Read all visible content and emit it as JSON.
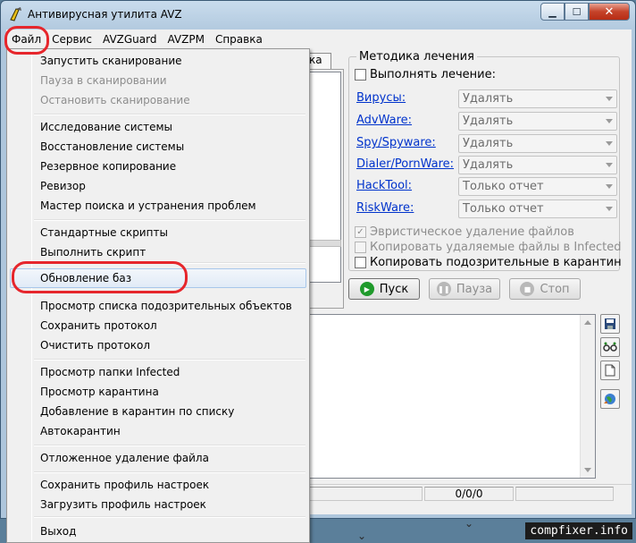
{
  "window": {
    "title": "Антивирусная утилита AVZ",
    "caption": {
      "minimize": "▁",
      "maximize": "☐",
      "close": "✕"
    }
  },
  "menubar": [
    "Файл",
    "Сервис",
    "AVZGuard",
    "AVZPM",
    "Справка"
  ],
  "file_menu": {
    "items": [
      {
        "label": "Запустить сканирование",
        "enabled": true
      },
      {
        "label": "Пауза в сканировании",
        "enabled": false
      },
      {
        "label": "Остановить сканирование",
        "enabled": false
      },
      {
        "label": "Исследование системы",
        "enabled": true
      },
      {
        "label": "Восстановление системы",
        "enabled": true
      },
      {
        "label": "Резервное копирование",
        "enabled": true
      },
      {
        "label": "Ревизор",
        "enabled": true
      },
      {
        "label": "Мастер поиска и устранения проблем",
        "enabled": true
      },
      {
        "label": "Стандартные скрипты",
        "enabled": true
      },
      {
        "label": "Выполнить скрипт",
        "enabled": true
      },
      {
        "label": "Обновление баз",
        "enabled": true,
        "highlighted": true
      },
      {
        "label": "Просмотр списка подозрительных объектов",
        "enabled": true
      },
      {
        "label": "Сохранить протокол",
        "enabled": true
      },
      {
        "label": "Очистить протокол",
        "enabled": true
      },
      {
        "label": "Просмотр папки Infected",
        "enabled": true
      },
      {
        "label": "Просмотр карантина",
        "enabled": true
      },
      {
        "label": "Добавление в карантин по списку",
        "enabled": true
      },
      {
        "label": "Автокарантин",
        "enabled": true
      },
      {
        "label": "Отложенное удаление файла",
        "enabled": true
      },
      {
        "label": "Сохранить профиль настроек",
        "enabled": true
      },
      {
        "label": "Загрузить профиль настроек",
        "enabled": true
      },
      {
        "label": "Выход",
        "enabled": true
      }
    ]
  },
  "tab_fragment": "ка",
  "treatment": {
    "group_title": "Методика лечения",
    "perform_treatment_label": "Выполнять лечение:",
    "threats": [
      {
        "name": "Вирусы:",
        "action": "Удалять"
      },
      {
        "name": "AdvWare:",
        "action": "Удалять"
      },
      {
        "name": "Spy/Spyware:",
        "action": "Удалять"
      },
      {
        "name": "Dialer/PornWare:",
        "action": "Удалять"
      },
      {
        "name": "HackTool:",
        "action": "Только отчет"
      },
      {
        "name": "RiskWare:",
        "action": "Только отчет"
      }
    ],
    "options": [
      {
        "label": "Эвристическое удаление файлов",
        "checked": true,
        "enabled": false
      },
      {
        "label": "Копировать удаляемые файлы в  Infected",
        "checked": false,
        "enabled": false
      },
      {
        "label": "Копировать подозрительные в  карантин",
        "checked": false,
        "enabled": true
      }
    ]
  },
  "controls": {
    "start": "Пуск",
    "pause": "Пауза",
    "stop": "Стоп"
  },
  "side_tools": [
    "save-icon",
    "glasses-icon",
    "document-icon",
    "globe-icon"
  ],
  "status": {
    "counter": "0/0/0"
  },
  "watermark": "compfixer.info",
  "colors": {
    "annotation": "#e6262c",
    "link": "#0033cc",
    "start_green": "#1f9a2b"
  }
}
